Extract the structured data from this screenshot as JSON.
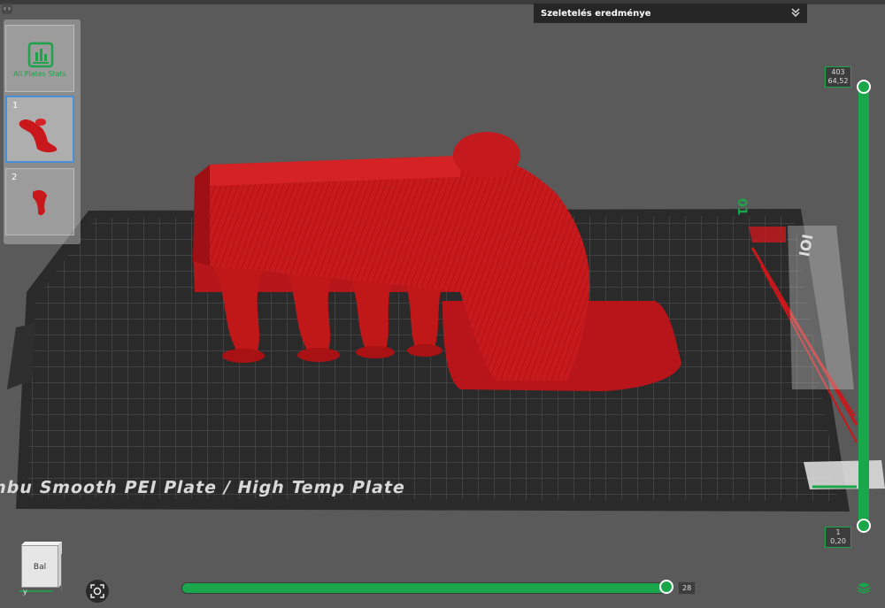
{
  "toolbar": {
    "collapse_glyph": "‹›"
  },
  "result_panel": {
    "title": "Szeletelés eredménye",
    "chevron_icon": "chevron-double-down-icon"
  },
  "plates": {
    "all_stats_label": "All Plates Stats",
    "items": [
      {
        "number": "1",
        "selected": true
      },
      {
        "number": "2",
        "selected": false
      }
    ]
  },
  "build_plate": {
    "label": "Bambu Smooth PEI Plate / High Temp Plate",
    "plate_number": "01",
    "brand_mark": "IOI"
  },
  "layer_slider": {
    "top_layer": "403",
    "top_height": "64,52",
    "bottom_layer": "1",
    "bottom_height": "0,20"
  },
  "move_slider": {
    "value": "28"
  },
  "view_cube": {
    "face_label": "Bal",
    "axis_label": "y"
  },
  "colors": {
    "accent": "#1aa64a",
    "model": "#c8181b",
    "plate": "#2b2b2b",
    "background": "#5a5a5a",
    "selection": "#4a90d9"
  }
}
